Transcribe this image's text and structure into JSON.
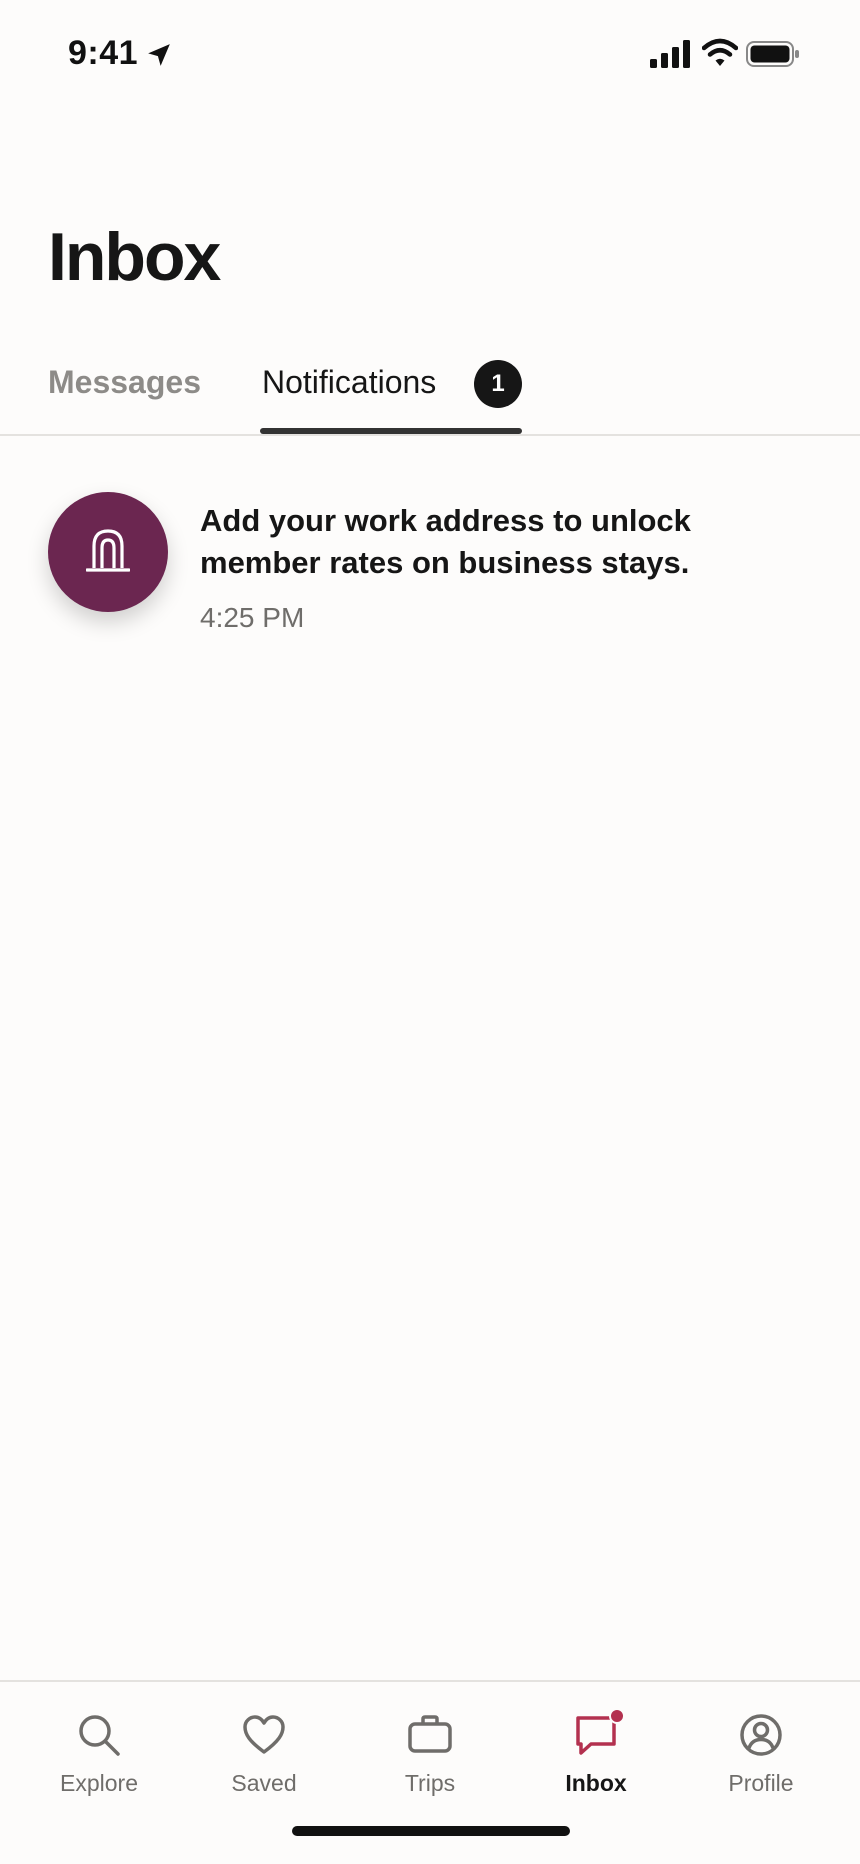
{
  "status_bar": {
    "time": "9:41"
  },
  "page": {
    "title": "Inbox"
  },
  "tabs": [
    {
      "label": "Messages",
      "active": false
    },
    {
      "label": "Notifications",
      "active": true,
      "badge": "1"
    }
  ],
  "notifications": [
    {
      "text": "Add your work address to unlock member rates on business stays.",
      "time": "4:25 PM",
      "icon": "arch-logo-icon"
    }
  ],
  "tab_bar": {
    "items": [
      {
        "label": "Explore",
        "icon": "search-icon",
        "active": false
      },
      {
        "label": "Saved",
        "icon": "heart-icon",
        "active": false
      },
      {
        "label": "Trips",
        "icon": "briefcase-icon",
        "active": false
      },
      {
        "label": "Inbox",
        "icon": "chat-bubble-icon",
        "active": true,
        "has_dot": true
      },
      {
        "label": "Profile",
        "icon": "user-circle-icon",
        "active": false
      }
    ]
  },
  "colors": {
    "background": "#fdfcfb",
    "accent": "#b3314f",
    "avatar": "#6b2650",
    "text_primary": "#161616",
    "text_secondary": "#6f6d6a"
  }
}
